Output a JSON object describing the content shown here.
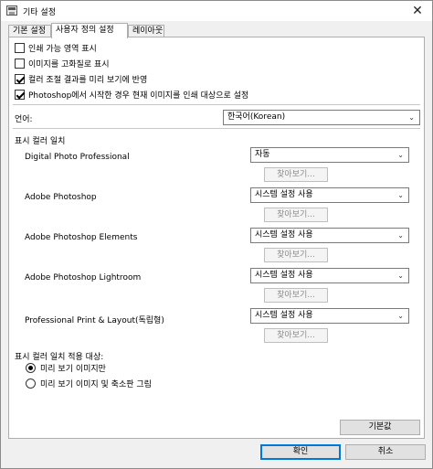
{
  "window": {
    "title": "기타 설정",
    "close_glyph": "✕"
  },
  "tabs": [
    {
      "label": "기본 설정"
    },
    {
      "label": "사용자 정의 설정"
    },
    {
      "label": "레이아웃"
    }
  ],
  "options": [
    {
      "label": "인쇄 가능 영역 표시",
      "checked": false
    },
    {
      "label": "이미지를 고화질로 표시",
      "checked": false
    },
    {
      "label": "컬러 조절 결과를 미리 보기에 반영",
      "checked": true
    },
    {
      "label": "Photoshop에서 시작한 경우 현재 이미지를 인쇄 대상으로 설정",
      "checked": true
    }
  ],
  "language": {
    "label": "언어:",
    "value": "한국어(Korean)"
  },
  "color_matching": {
    "section_label": "표시 컬러 일치",
    "apps": [
      {
        "name": "Digital Photo Professional",
        "value": "자동",
        "browse": "찾아보기..."
      },
      {
        "name": "Adobe Photoshop",
        "value": "시스템 설정 사용",
        "browse": "찾아보기..."
      },
      {
        "name": "Adobe Photoshop Elements",
        "value": "시스템 설정 사용",
        "browse": "찾아보기..."
      },
      {
        "name": "Adobe Photoshop Lightroom",
        "value": "시스템 설정 사용",
        "browse": "찾아보기..."
      },
      {
        "name": "Professional Print & Layout(독립형)",
        "value": "시스템 설정 사용",
        "browse": "찾아보기..."
      }
    ]
  },
  "apply_target": {
    "label": "표시 컬러 일치 적용 대상:",
    "options": [
      {
        "label": "미리 보기 이미지만",
        "selected": true
      },
      {
        "label": "미리 보기 이미지 및 축소판 그림",
        "selected": false
      }
    ]
  },
  "buttons": {
    "defaults": "기본값",
    "ok": "확인",
    "cancel": "취소"
  }
}
